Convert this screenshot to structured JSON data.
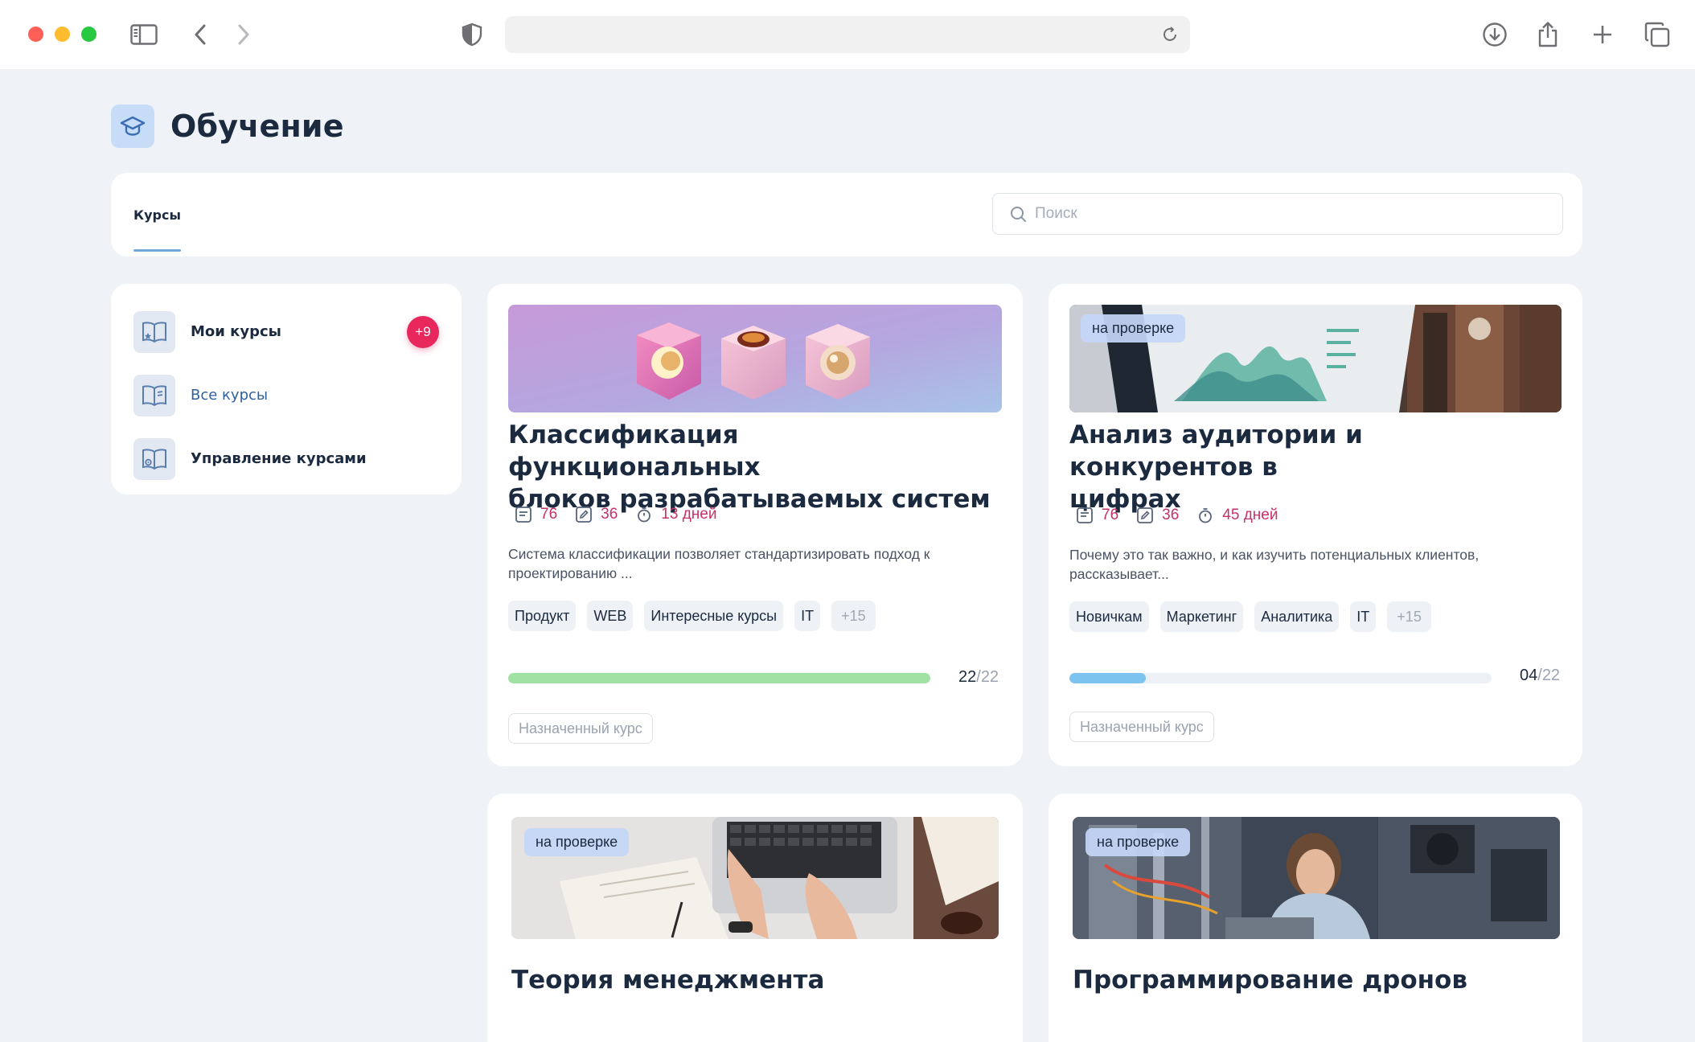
{
  "page": {
    "title": "Обучение"
  },
  "tabs": [
    {
      "label": "Курсы"
    }
  ],
  "search": {
    "placeholder": "Поиск"
  },
  "sidebar": {
    "items": [
      {
        "label": "Мои курсы",
        "badge": "+9"
      },
      {
        "label": "Все курсы"
      },
      {
        "label": "Управление курсами"
      }
    ]
  },
  "courses": [
    {
      "title_line1": "Классификация функциональных",
      "title_line2": "блоков разрабатываемых систем",
      "lessons": "76",
      "tasks": "36",
      "duration": "13 дней",
      "desc_line1": "Система классификации позволяет стандартизировать подход к",
      "desc_line2": "проектированию ...",
      "tags": [
        "Продукт",
        "WEB",
        "Интересные курсы",
        "IT",
        "+15"
      ],
      "progress": {
        "done": "22",
        "separator": "/",
        "total": "22",
        "fraction": 1.0,
        "color": "#9fe2a4"
      },
      "assigned": "Назначенный курс"
    },
    {
      "status": "на проверке",
      "title_line1": "Анализ аудитории и конкурентов в",
      "title_line2": "цифрах",
      "lessons": "76",
      "tasks": "36",
      "duration": "45 дней",
      "desc_line1": "Почему это так важно, и как изучить потенциальных клиентов,",
      "desc_line2": "рассказывает...",
      "tags": [
        "Новичкам",
        "Маркетинг",
        "Аналитика",
        "IT",
        "+15"
      ],
      "progress": {
        "done": "04",
        "separator": "/",
        "total": "22",
        "fraction": 0.18,
        "color": "#7cc3ef"
      },
      "assigned": "Назначенный курс"
    },
    {
      "status": "на проверке",
      "title": "Теория менеджмента"
    },
    {
      "status": "на проверке",
      "title": "Программирование дронов"
    }
  ],
  "colors": {
    "accent": "#73a8db",
    "badge": "#e8275c",
    "stat": "#c73068",
    "background": "#eff2f7"
  }
}
